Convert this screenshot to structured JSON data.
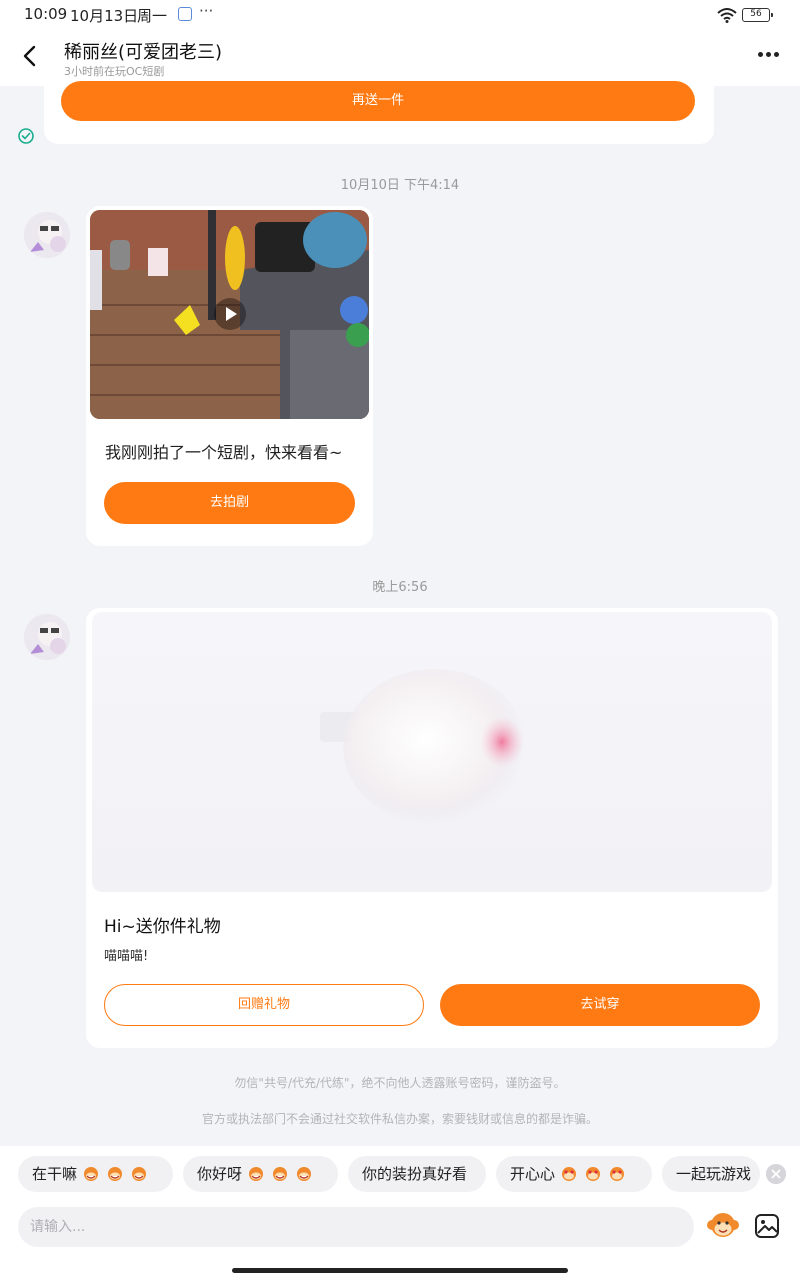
{
  "status_bar": {
    "time": "10:09",
    "date": "10月13日",
    "weekday": "周一",
    "more": "···",
    "battery": "56"
  },
  "header": {
    "title": "稀丽丝(可爱团老三)",
    "subtitle": "3小时前在玩OC短剧"
  },
  "top_card": {
    "button_label": "再送一件"
  },
  "messages": [
    {
      "timestamp": "10月10日 下午4:14",
      "text": "我刚刚拍了一个短剧，快来看看~",
      "button_label": "去拍剧"
    },
    {
      "timestamp": "晚上6:56",
      "title": "Hi~送你件礼物",
      "text": "喵喵喵!",
      "secondary_button": "回赠礼物",
      "primary_button": "去试穿"
    }
  ],
  "notices": [
    "勿信\"共号/代充/代练\"，绝不向他人透露账号密码，谨防盗号。",
    "官方或执法部门不会通过社交软件私信办案，索要钱财或信息的都是诈骗。"
  ],
  "quick_replies": [
    {
      "label": "在干嘛",
      "emoji": "monkey-laugh-icon"
    },
    {
      "label": "你好呀",
      "emoji": "monkey-laugh-icon"
    },
    {
      "label": "你的装扮真好看",
      "emoji": ""
    },
    {
      "label": "开心心",
      "emoji": "monkey-heart-icon"
    },
    {
      "label": "一起玩游戏",
      "emoji": ""
    }
  ],
  "input": {
    "placeholder": "请输入..."
  },
  "colors": {
    "accent": "#ff7a12",
    "background": "#f3f4f8",
    "sent_check": "#1aad8f"
  }
}
